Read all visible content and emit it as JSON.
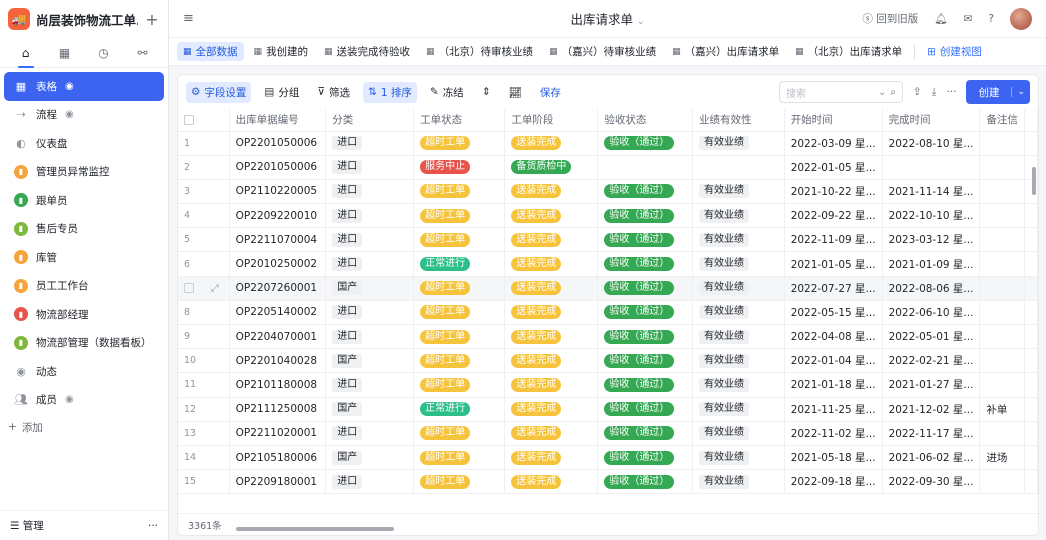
{
  "app": {
    "title": "尚层装饰物流工单..."
  },
  "sidebar": {
    "menu": [
      {
        "label": "表格",
        "icon": "grid-icon",
        "eye": true,
        "active": true
      },
      {
        "label": "流程",
        "icon": "flow-icon",
        "eye": true
      },
      {
        "label": "仪表盘",
        "icon": "dashboard-icon"
      },
      {
        "label": "管理员异常监控",
        "icon": "chart-icon",
        "color": "#f5a33c"
      },
      {
        "label": "跟单员",
        "icon": "chart-icon",
        "color": "#35a853"
      },
      {
        "label": "售后专员",
        "icon": "chart-icon",
        "color": "#7fb93c"
      },
      {
        "label": "库管",
        "icon": "chart-icon",
        "color": "#f5a33c"
      },
      {
        "label": "员工工作台",
        "icon": "chart-icon",
        "color": "#f5a33c"
      },
      {
        "label": "物流部经理",
        "icon": "chart-icon",
        "color": "#e8544a"
      },
      {
        "label": "物流部管理（数据看板）",
        "icon": "chart-icon",
        "color": "#7fb93c"
      },
      {
        "label": "动态",
        "icon": "activity-icon"
      },
      {
        "label": "成员",
        "icon": "members-icon",
        "eye": true
      }
    ],
    "add_label": "添加",
    "footer_label": "管理"
  },
  "topbar": {
    "title": "出库请求单",
    "back_label": "回到旧版"
  },
  "views": [
    {
      "label": "全部数据",
      "active": true
    },
    {
      "label": "我创建的"
    },
    {
      "label": "送装完成待验收"
    },
    {
      "label": "（北京）待审核业绩"
    },
    {
      "label": "（嘉兴）待审核业绩"
    },
    {
      "label": "（嘉兴）出库请求单"
    },
    {
      "label": "（北京）出库请求单"
    }
  ],
  "create_view_label": "创建视图",
  "toolbar": {
    "field_settings": "字段设置",
    "group": "分组",
    "filter": "筛选",
    "sort": "1 排序",
    "freeze": "冻结",
    "save": "保存",
    "search_placeholder": "搜索",
    "create": "创建"
  },
  "table": {
    "columns": [
      "出库单据编号",
      "分类",
      "工单状态",
      "工单阶段",
      "验收状态",
      "业绩有效性",
      "开始时间",
      "完成时间",
      "备注信"
    ],
    "rows": [
      {
        "idx": "1",
        "no": "OP2201050006",
        "cat": "进口",
        "status": "超时工单",
        "status_c": "orange",
        "stage": "送装完成",
        "stage_c": "orange",
        "acc": "验收（通过）",
        "valid": "有效业绩",
        "start": "2022-03-09 星...",
        "end": "2022-08-10 星...",
        "note": ""
      },
      {
        "idx": "2",
        "no": "OP2201050006",
        "cat": "进口",
        "status": "服务中止",
        "status_c": "red",
        "stage": "备货质检中",
        "stage_c": "green",
        "acc": "",
        "valid": "",
        "start": "2022-01-05 星...",
        "end": "",
        "note": ""
      },
      {
        "idx": "3",
        "no": "OP2110220005",
        "cat": "进口",
        "status": "超时工单",
        "status_c": "orange",
        "stage": "送装完成",
        "stage_c": "orange",
        "acc": "验收（通过）",
        "valid": "有效业绩",
        "start": "2021-10-22 星...",
        "end": "2021-11-14 星...",
        "note": ""
      },
      {
        "idx": "4",
        "no": "OP2209220010",
        "cat": "进口",
        "status": "超时工单",
        "status_c": "orange",
        "stage": "送装完成",
        "stage_c": "orange",
        "acc": "验收（通过）",
        "valid": "有效业绩",
        "start": "2022-09-22 星...",
        "end": "2022-10-10 星...",
        "note": ""
      },
      {
        "idx": "5",
        "no": "OP2211070004",
        "cat": "进口",
        "status": "超时工单",
        "status_c": "orange",
        "stage": "送装完成",
        "stage_c": "orange",
        "acc": "验收（通过）",
        "valid": "有效业绩",
        "start": "2022-11-09 星...",
        "end": "2023-03-12 星...",
        "note": ""
      },
      {
        "idx": "6",
        "no": "OP2010250002",
        "cat": "进口",
        "status": "正常进行",
        "status_c": "teal",
        "stage": "送装完成",
        "stage_c": "orange",
        "acc": "验收（通过）",
        "valid": "有效业绩",
        "start": "2021-01-05 星...",
        "end": "2021-01-09 星...",
        "note": ""
      },
      {
        "idx": "",
        "no": "OP2207260001",
        "cat": "国产",
        "status": "超时工单",
        "status_c": "orange",
        "stage": "送装完成",
        "stage_c": "orange",
        "acc": "验收（通过）",
        "valid": "有效业绩",
        "start": "2022-07-27 星...",
        "end": "2022-08-06 星...",
        "note": "",
        "hover": true
      },
      {
        "idx": "8",
        "no": "OP2205140002",
        "cat": "进口",
        "status": "超时工单",
        "status_c": "orange",
        "stage": "送装完成",
        "stage_c": "orange",
        "acc": "验收（通过）",
        "valid": "有效业绩",
        "start": "2022-05-15 星...",
        "end": "2022-06-10 星...",
        "note": ""
      },
      {
        "idx": "9",
        "no": "OP2204070001",
        "cat": "进口",
        "status": "超时工单",
        "status_c": "orange",
        "stage": "送装完成",
        "stage_c": "orange",
        "acc": "验收（通过）",
        "valid": "有效业绩",
        "start": "2022-04-08 星...",
        "end": "2022-05-01 星...",
        "note": ""
      },
      {
        "idx": "10",
        "no": "OP2201040028",
        "cat": "国产",
        "status": "超时工单",
        "status_c": "orange",
        "stage": "送装完成",
        "stage_c": "orange",
        "acc": "验收（通过）",
        "valid": "有效业绩",
        "start": "2022-01-04 星...",
        "end": "2022-02-21 星...",
        "note": ""
      },
      {
        "idx": "11",
        "no": "OP2101180008",
        "cat": "进口",
        "status": "超时工单",
        "status_c": "orange",
        "stage": "送装完成",
        "stage_c": "orange",
        "acc": "验收（通过）",
        "valid": "有效业绩",
        "start": "2021-01-18 星...",
        "end": "2021-01-27 星...",
        "note": ""
      },
      {
        "idx": "12",
        "no": "OP2111250008",
        "cat": "国产",
        "status": "正常进行",
        "status_c": "teal",
        "stage": "送装完成",
        "stage_c": "orange",
        "acc": "验收（通过）",
        "valid": "有效业绩",
        "start": "2021-11-25 星...",
        "end": "2021-12-02 星...",
        "note": "补单"
      },
      {
        "idx": "13",
        "no": "OP2211020001",
        "cat": "进口",
        "status": "超时工单",
        "status_c": "orange",
        "stage": "送装完成",
        "stage_c": "orange",
        "acc": "验收（通过）",
        "valid": "有效业绩",
        "start": "2022-11-02 星...",
        "end": "2022-11-17 星...",
        "note": ""
      },
      {
        "idx": "14",
        "no": "OP2105180006",
        "cat": "国产",
        "status": "超时工单",
        "status_c": "orange",
        "stage": "送装完成",
        "stage_c": "orange",
        "acc": "验收（通过）",
        "valid": "有效业绩",
        "start": "2021-05-18 星...",
        "end": "2021-06-02 星...",
        "note": "进场"
      },
      {
        "idx": "15",
        "no": "OP2209180001",
        "cat": "进口",
        "status": "超时工单",
        "status_c": "orange",
        "stage": "送装完成",
        "stage_c": "orange",
        "acc": "验收（通过）",
        "valid": "有效业绩",
        "start": "2022-09-18 星...",
        "end": "2022-09-30 星...",
        "note": ""
      }
    ]
  },
  "footer": {
    "count": "3361条"
  }
}
